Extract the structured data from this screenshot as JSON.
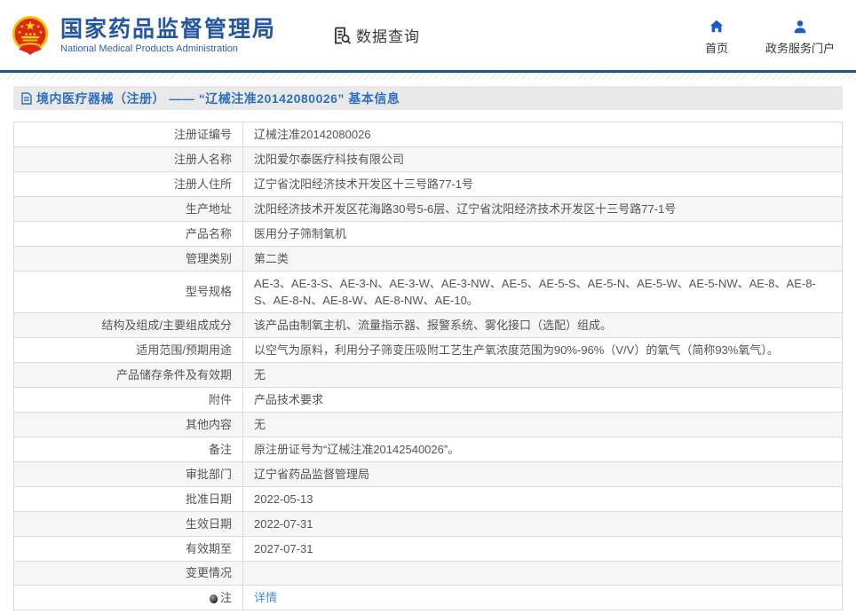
{
  "header": {
    "logo_title": "国家药品监督管理局",
    "logo_subtitle": "National Medical Products Administration",
    "section_label": "数据查询",
    "nav": [
      {
        "label": "首页",
        "icon": "home-icon"
      },
      {
        "label": "政务服务门户",
        "icon": "user-icon"
      }
    ]
  },
  "breadcrumb": {
    "title": "境内医疗器械（注册） —— “辽械注准20142080026” 基本信息"
  },
  "table": {
    "rows": [
      {
        "label": "注册证编号",
        "value": "辽械注准20142080026"
      },
      {
        "label": "注册人名称",
        "value": "沈阳爱尔泰医疗科技有限公司"
      },
      {
        "label": "注册人住所",
        "value": "辽宁省沈阳经济技术开发区十三号路77-1号"
      },
      {
        "label": "生产地址",
        "value": "沈阳经济技术开发区花海路30号5-6层、辽宁省沈阳经济技术开发区十三号路77-1号"
      },
      {
        "label": "产品名称",
        "value": "医用分子筛制氧机"
      },
      {
        "label": "管理类别",
        "value": "第二类"
      },
      {
        "label": "型号规格",
        "value": "AE-3、AE-3-S、AE-3-N、AE-3-W、AE-3-NW、AE-5、AE-5-S、AE-5-N、AE-5-W、AE-5-NW、AE-8、AE-8-S、AE-8-N、AE-8-W、AE-8-NW、AE-10。"
      },
      {
        "label": "结构及组成/主要组成成分",
        "value": "该产品由制氧主机、流量指示器、报警系统、雾化接口（选配）组成。"
      },
      {
        "label": "适用范围/预期用途",
        "value": "以空气为原料，利用分子筛变压吸附工艺生产氧浓度范围为90%-96%（V/V）的氧气（简称93%氧气）。"
      },
      {
        "label": "产品储存条件及有效期",
        "value": "无"
      },
      {
        "label": "附件",
        "value": "产品技术要求"
      },
      {
        "label": "其他内容",
        "value": "无"
      },
      {
        "label": "备注",
        "value": "原注册证号为“辽械注准20142540026”。"
      },
      {
        "label": "审批部门",
        "value": "辽宁省药品监督管理局"
      },
      {
        "label": "批准日期",
        "value": "2022-05-13"
      },
      {
        "label": "生效日期",
        "value": "2022-07-31"
      },
      {
        "label": "有效期至",
        "value": "2027-07-31"
      },
      {
        "label": "变更情况",
        "value": ""
      },
      {
        "label": "注",
        "value": "详情",
        "link": true,
        "icon": "note-icon"
      }
    ]
  },
  "colors": {
    "brand_blue": "#2456a4",
    "divider_navy": "#1c5588",
    "crumb_bg": "#e9e9e9",
    "crumb_text": "#2e6fbe",
    "nav_icon_blue": "#1a5dc8",
    "table_border": "#dcdcdc",
    "row_alt_bg": "#f6f6f6",
    "text": "#555555",
    "link": "#4a90d9",
    "emblem_red": "#de2910",
    "emblem_gold": "#ffde00"
  }
}
